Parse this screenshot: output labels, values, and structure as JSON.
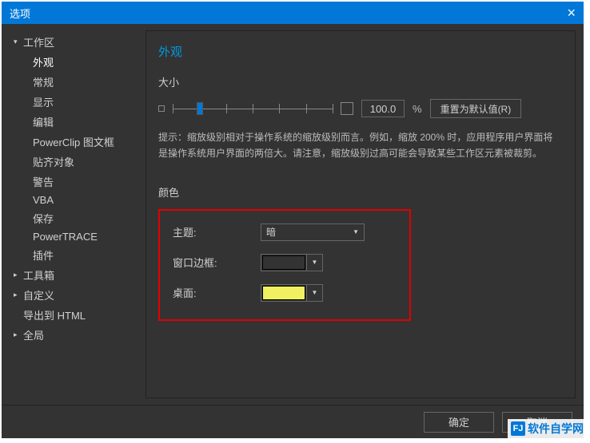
{
  "window": {
    "title": "选项"
  },
  "sidebar": {
    "workspace": "工作区",
    "items": [
      "外观",
      "常规",
      "显示",
      "编辑",
      "PowerClip 图文框",
      "贴齐对象",
      "警告",
      "VBA",
      "保存",
      "PowerTRACE",
      "插件"
    ],
    "toolbox": "工具箱",
    "custom": "自定义",
    "export_html": "导出到 HTML",
    "global": "全局"
  },
  "content": {
    "title": "外观",
    "size_label": "大小",
    "size_value": "100.0",
    "percent": "%",
    "reset_btn": "重置为默认值(R)",
    "hint": "提示：缩放级别相对于操作系统的缩放级别而言。例如，缩放 200% 时，应用程序用户界面将是操作系统用户界面的两倍大。请注意，缩放级别过高可能会导致某些工作区元素被裁剪。",
    "color_label": "颜色",
    "theme_label": "主题:",
    "theme_value": "暗",
    "border_label": "窗口边框:",
    "border_color": "#1a6fe6",
    "desktop_label": "桌面:",
    "desktop_color": "#f0f060"
  },
  "footer": {
    "ok": "确定",
    "cancel": "取消"
  },
  "watermark": {
    "text": "软件自学网"
  }
}
